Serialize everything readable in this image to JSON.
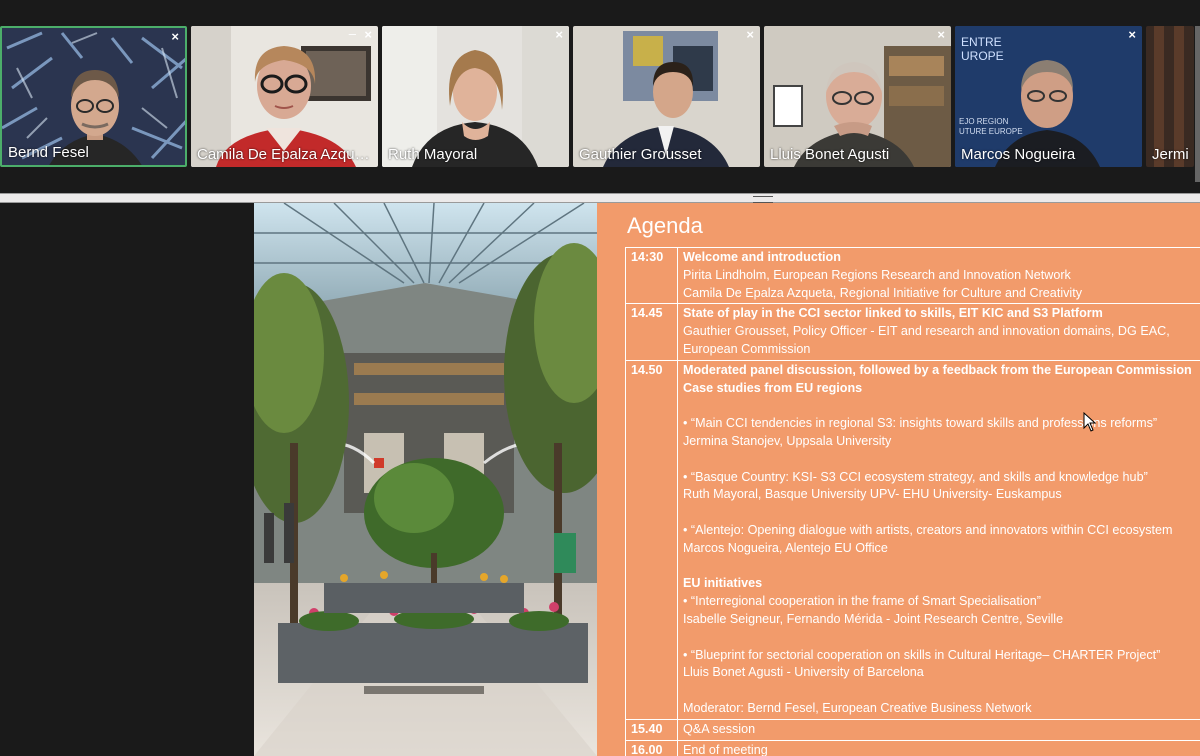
{
  "participants": [
    {
      "name": "Bernd Fesel",
      "active": true
    },
    {
      "name": "Camila De Epalza Azqu…",
      "active": false
    },
    {
      "name": "Ruth Mayoral",
      "active": false
    },
    {
      "name": "Gauthier Grousset",
      "active": false
    },
    {
      "name": "Lluis Bonet Agusti",
      "active": false
    },
    {
      "name": "Marcos Nogueira",
      "active": false
    },
    {
      "name": "Jermi",
      "active": false
    }
  ],
  "tile_controls": {
    "close": "×",
    "minimize": "–"
  },
  "marcos_background": {
    "line1": "ENTRE",
    "line2": "UROPE",
    "line3": "EJO REGION",
    "line4": "UTURE EUROPE"
  },
  "agenda": {
    "title": "Agenda",
    "rows": [
      {
        "time": "14:30",
        "lines": [
          {
            "text": "Welcome and introduction",
            "bold": true
          },
          {
            "text": "Pirita Lindholm, European Regions Research and Innovation Network",
            "bold": false
          },
          {
            "text": "Camila De Epalza Azqueta, Regional Initiative for Culture and Creativity",
            "bold": false
          }
        ]
      },
      {
        "time": "14.45",
        "lines": [
          {
            "text": "State of play in the CCI sector linked to skills, EIT KIC and S3 Platform",
            "bold": true
          },
          {
            "text": "Gauthier Grousset, Policy Officer - EIT and research and innovation domains, DG EAC,",
            "bold": false
          },
          {
            "text": "European Commission",
            "bold": false
          }
        ]
      },
      {
        "time": "14.50",
        "lines": [
          {
            "text": "Moderated panel discussion, followed by a feedback from the European Commission",
            "bold": true
          },
          {
            "text": "Case studies from EU regions",
            "bold": true
          },
          {
            "text": "",
            "bold": false
          },
          {
            "text": "• “Main CCI tendencies in regional S3: insights toward skills and professions reforms”",
            "bold": false
          },
          {
            "text": "Jermina Stanojev, Uppsala University",
            "bold": false
          },
          {
            "text": "",
            "bold": false
          },
          {
            "text": "• “Basque Country: KSI- S3 CCI ecosystem strategy, and skills and knowledge hub”",
            "bold": false
          },
          {
            "text": "Ruth Mayoral, Basque University UPV- EHU University- Euskampus",
            "bold": false
          },
          {
            "text": "",
            "bold": false
          },
          {
            "text": "• “Alentejo: Opening dialogue with artists, creators and innovators within CCI ecosystem",
            "bold": false
          },
          {
            "text": "Marcos Nogueira, Alentejo EU Office",
            "bold": false
          },
          {
            "text": "",
            "bold": false
          },
          {
            "text": "EU initiatives",
            "bold": true
          },
          {
            "text": "• “Interregional cooperation in the frame of Smart Specialisation”",
            "bold": false
          },
          {
            "text": "Isabelle Seigneur, Fernando Mérida - Joint Research Centre, Seville",
            "bold": false
          },
          {
            "text": "",
            "bold": false
          },
          {
            "text": "• “Blueprint for sectorial cooperation on skills in Cultural Heritage– CHARTER Project”",
            "bold": false
          },
          {
            "text": "Lluis Bonet Agusti - University of Barcelona",
            "bold": false
          },
          {
            "text": "",
            "bold": false
          },
          {
            "text": "Moderator: Bernd Fesel, European Creative Business Network",
            "bold": false
          }
        ]
      },
      {
        "time": "15.40",
        "lines": [
          {
            "text": "Q&A session",
            "bold": false
          }
        ]
      },
      {
        "time": "16.00",
        "lines": [
          {
            "text": "End of meeting",
            "bold": false
          }
        ]
      }
    ]
  },
  "colors": {
    "slide_bg": "#f29b6b",
    "active_border": "#4cae6a",
    "app_bg": "#1a1a1a"
  }
}
